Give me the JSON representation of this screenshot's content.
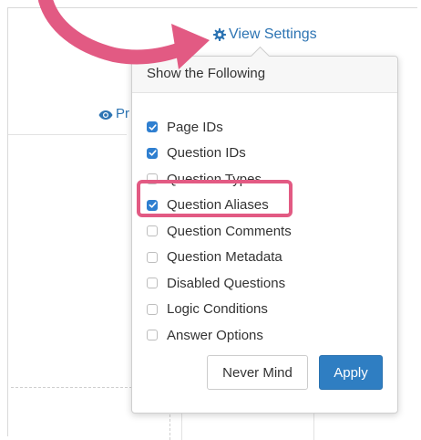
{
  "toolbar": {
    "view_settings_label": "View Settings",
    "preview_label": "Pr"
  },
  "popover": {
    "title": "Show the Following",
    "options": [
      {
        "label": "Page IDs",
        "checked": true
      },
      {
        "label": "Question IDs",
        "checked": true
      },
      {
        "label": "Question Types",
        "checked": false
      },
      {
        "label": "Question Aliases",
        "checked": true
      },
      {
        "label": "Question Comments",
        "checked": false
      },
      {
        "label": "Question Metadata",
        "checked": false
      },
      {
        "label": "Disabled Questions",
        "checked": false
      },
      {
        "label": "Logic Conditions",
        "checked": false
      },
      {
        "label": "Answer Options",
        "checked": false
      }
    ],
    "never_mind_label": "Never Mind",
    "apply_label": "Apply"
  },
  "icons": {
    "settings": "gear-icon",
    "preview": "eye-icon",
    "checkmark": "check-icon",
    "annotation": "arrow-annotation"
  },
  "colors": {
    "link": "#2d74b3",
    "checkbox_checked": "#2f7fd0",
    "apply_button": "#2f7ec2",
    "annotation": "#e25a83"
  }
}
